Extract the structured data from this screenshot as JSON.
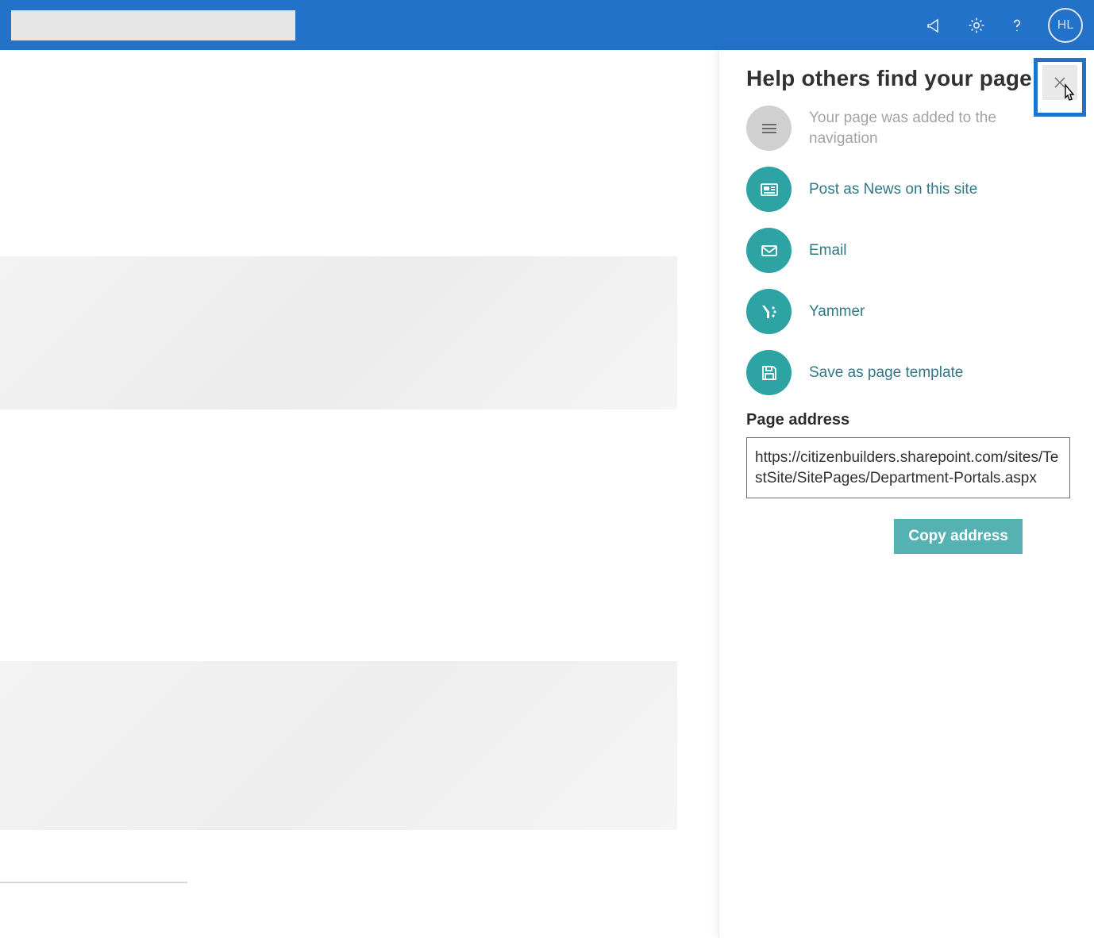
{
  "header": {
    "avatar_initials": "HL"
  },
  "panel": {
    "title": "Help others find your page",
    "options": {
      "navigation_added": "Your page was added to the navigation",
      "post_news": "Post as News on this site",
      "email": "Email",
      "yammer": "Yammer",
      "save_template": "Save as page template"
    },
    "page_address_label": "Page address",
    "page_address": "https://citizenbuilders.sharepoint.com/sites/TestSite/SitePages/Department-Portals.aspx",
    "copy_button": "Copy address"
  }
}
